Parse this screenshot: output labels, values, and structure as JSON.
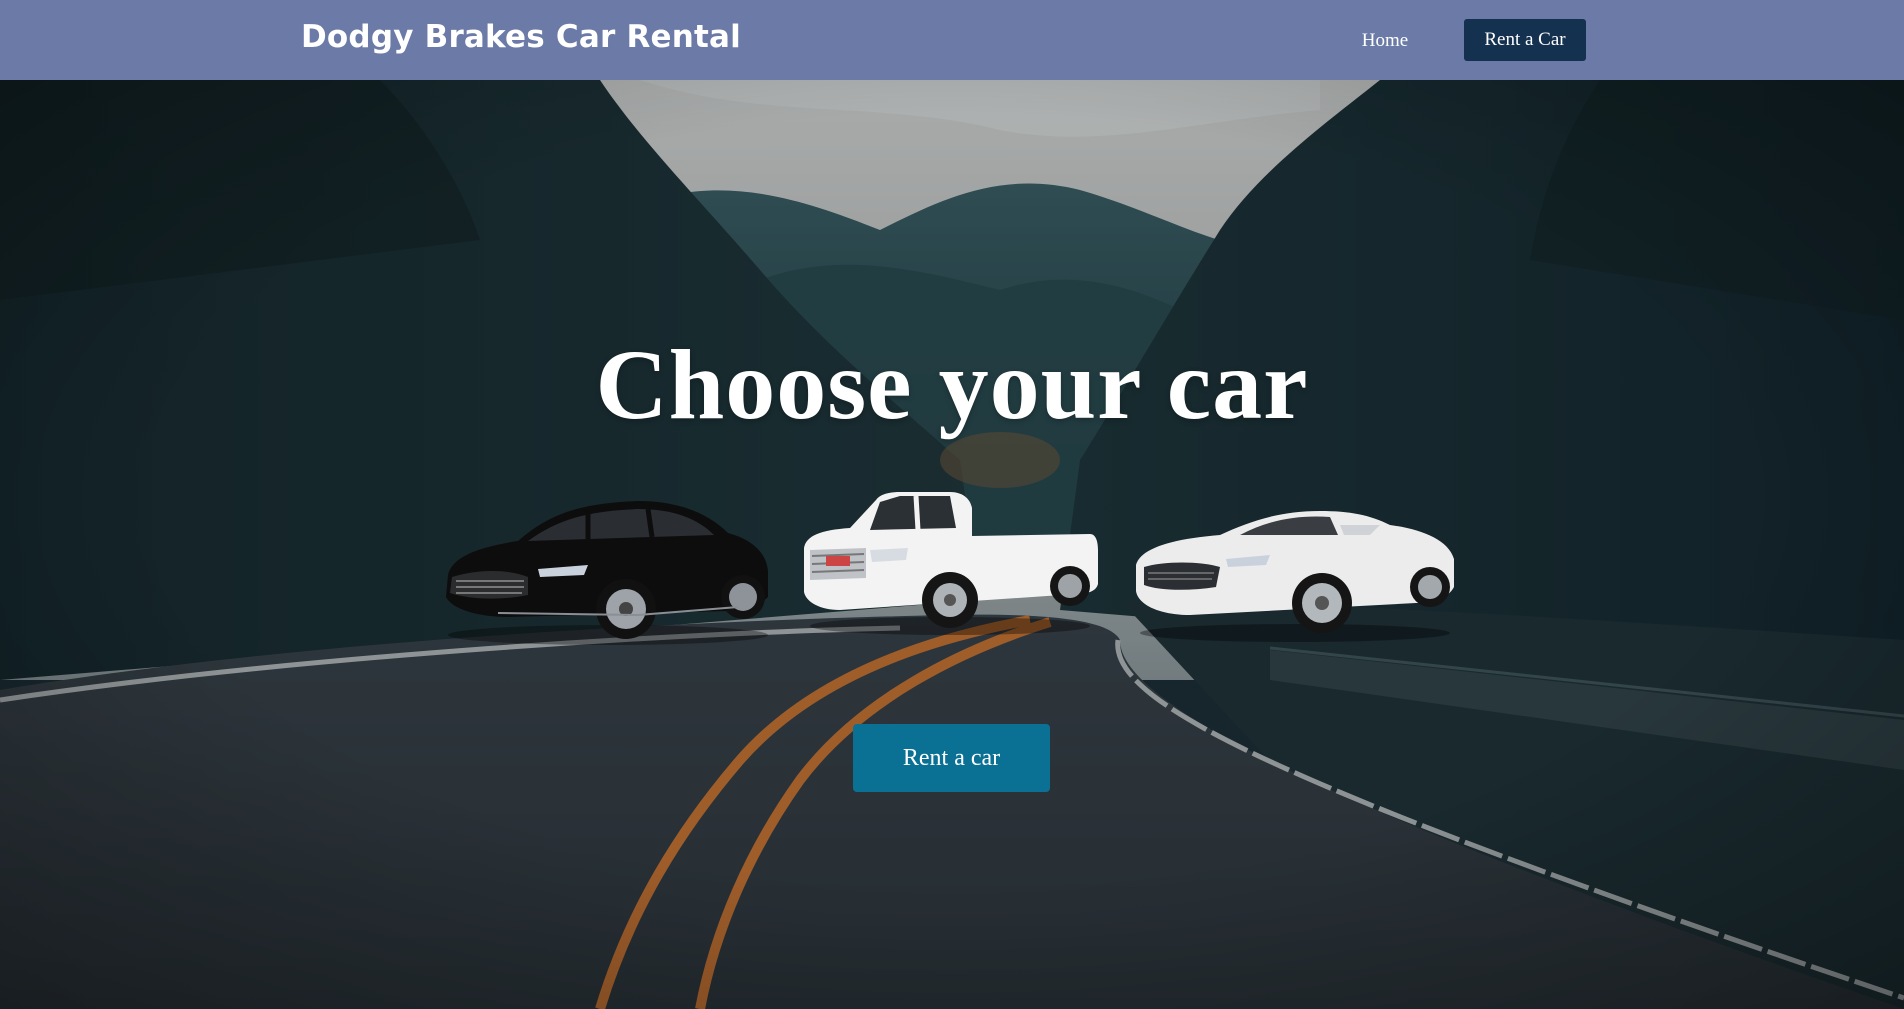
{
  "nav": {
    "brand": "Dodgy Brakes Car Rental",
    "home_label": "Home",
    "rent_label": "Rent a Car"
  },
  "hero": {
    "title": "Choose your car",
    "cta_label": "Rent a car",
    "cars": [
      "black-sedan",
      "white-pickup-truck",
      "white-convertible-sports-car"
    ]
  },
  "colors": {
    "navbar": "#6b7aa6",
    "nav_button": "#14324f",
    "cta_button": "#0b7194",
    "road_line": "#d9782e"
  }
}
